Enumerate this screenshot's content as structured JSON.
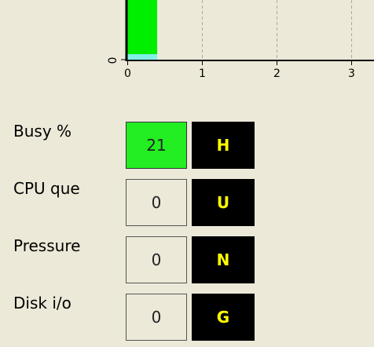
{
  "colors": {
    "background": "#ece9d8",
    "bar_fill": "#00ee00",
    "bar_base": "#80f0e8",
    "active_meter": "#22ee22",
    "code_background": "#000000",
    "code_text": "#ffff00"
  },
  "chart_data": {
    "type": "bar",
    "y_tick_labels": [
      "0"
    ],
    "x_tick_labels": [
      "0",
      "1",
      "2",
      "3"
    ],
    "x_ticks": [
      0,
      1,
      2,
      3
    ],
    "xlim": [
      0,
      3.3
    ],
    "grid": "vertical dashed",
    "series": [
      {
        "x_start": 0,
        "x_end": 0.4,
        "color": "#00ee00"
      }
    ]
  },
  "meters": [
    {
      "label": "Busy %",
      "value": "21",
      "code": "H",
      "active": true
    },
    {
      "label": "CPU que",
      "value": "0",
      "code": "U",
      "active": false
    },
    {
      "label": "Pressure",
      "value": "0",
      "code": "N",
      "active": false
    },
    {
      "label": "Disk i/o",
      "value": "0",
      "code": "G",
      "active": false
    }
  ]
}
